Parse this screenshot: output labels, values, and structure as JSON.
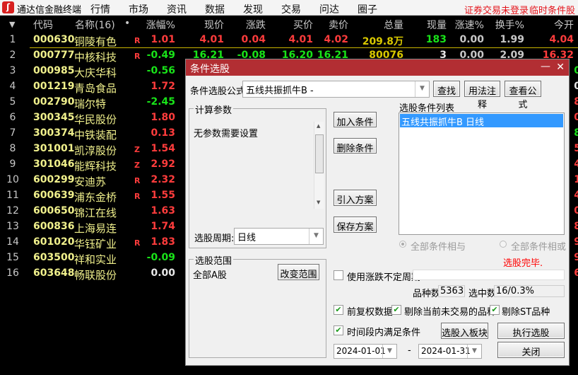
{
  "app": {
    "title": "通达信金融终端",
    "menu": [
      "行情",
      "市场",
      "资讯",
      "数据",
      "发现",
      "交易",
      "问达",
      "圈子"
    ],
    "login_status": "证券交易未登录",
    "temp_label": "临时条件股"
  },
  "table": {
    "headers": {
      "sort": "▼",
      "code": "代码",
      "name": "名称(16)",
      "dot": "•",
      "pct": "涨幅%",
      "price": "现价",
      "chg": "涨跌",
      "bid": "买价",
      "ask": "卖价",
      "vol": "总量",
      "cur": "现量",
      "speed": "涨速%",
      "turn": "换手%",
      "open": "今开"
    },
    "rows": [
      {
        "idx": "1",
        "code": "000630",
        "name": "铜陵有色",
        "mark": "R",
        "pct": "1.01",
        "price": "4.01",
        "chg": "0.04",
        "bid": "4.01",
        "ask": "4.02",
        "vol": "209.8万",
        "cur": "183",
        "speed": "0.00",
        "turn": "1.99",
        "open": "4.04",
        "color": "red"
      },
      {
        "idx": "2",
        "code": "000777",
        "name": "中核科技",
        "mark": "R",
        "pct": "-0.49",
        "price": "16.21",
        "chg": "-0.08",
        "bid": "16.20",
        "ask": "16.21",
        "vol": "80076",
        "cur": "3",
        "speed": "0.00",
        "turn": "2.09",
        "open": "16.32",
        "color": "grn"
      },
      {
        "idx": "3",
        "code": "000985",
        "name": "大庆华科",
        "mark": "",
        "pct": "-0.56",
        "open": "0",
        "color": "grn",
        "ocolor": "grn"
      },
      {
        "idx": "4",
        "code": "001219",
        "name": "青岛食品",
        "mark": "",
        "pct": "1.72",
        "open": "0",
        "color": "red",
        "ocolor": "wht"
      },
      {
        "idx": "5",
        "code": "002790",
        "name": "瑞尔特",
        "mark": "",
        "pct": "-2.45",
        "open": "8",
        "color": "grn",
        "ocolor": "red"
      },
      {
        "idx": "6",
        "code": "300345",
        "name": "华民股份",
        "mark": "",
        "pct": "1.80",
        "open": "0",
        "color": "red",
        "ocolor": "red"
      },
      {
        "idx": "7",
        "code": "300374",
        "name": "中铁装配",
        "mark": "",
        "pct": "0.13",
        "open": "8",
        "color": "red",
        "ocolor": "grn"
      },
      {
        "idx": "8",
        "code": "301001",
        "name": "凯淳股份",
        "mark": "Z",
        "pct": "1.54",
        "open": "5",
        "color": "red",
        "ocolor": "red"
      },
      {
        "idx": "9",
        "code": "301046",
        "name": "能辉科技",
        "mark": "Z",
        "pct": "2.92",
        "open": "4",
        "color": "red",
        "ocolor": "red"
      },
      {
        "idx": "10",
        "code": "600299",
        "name": "安迪苏",
        "mark": "R",
        "pct": "2.32",
        "open": "1",
        "color": "red",
        "ocolor": "red"
      },
      {
        "idx": "11",
        "code": "600639",
        "name": "浦东金桥",
        "mark": "R",
        "pct": "1.55",
        "open": "4",
        "color": "red",
        "ocolor": "red"
      },
      {
        "idx": "12",
        "code": "600650",
        "name": "锦江在线",
        "mark": "",
        "pct": "1.63",
        "open": "0",
        "color": "red",
        "ocolor": "red"
      },
      {
        "idx": "13",
        "code": "600836",
        "name": "上海易连",
        "mark": "",
        "pct": "1.74",
        "open": "8",
        "color": "red",
        "ocolor": "red"
      },
      {
        "idx": "14",
        "code": "601020",
        "name": "华钰矿业",
        "mark": "R",
        "pct": "1.83",
        "open": "9",
        "color": "red",
        "ocolor": "red"
      },
      {
        "idx": "15",
        "code": "603500",
        "name": "祥和实业",
        "mark": "",
        "pct": "-0.09",
        "open": "9",
        "color": "grn",
        "ocolor": "red"
      },
      {
        "idx": "16",
        "code": "603648",
        "name": "畅联股份",
        "mark": "",
        "pct": "0.00",
        "open": "6",
        "color": "wht",
        "ocolor": "red"
      }
    ]
  },
  "dialog": {
    "title": "条件选股",
    "minimize": "—",
    "close": "✕",
    "formula_label": "条件选股公式",
    "formula_value": "五线共振抓牛B -",
    "find": "查找",
    "usage": "用法注释",
    "view_formula": "查看公式",
    "params_group": "计算参数",
    "params_text": "无参数需要设置",
    "period_label": "选股周期:",
    "period_value": "日线",
    "add": "加入条件",
    "delete": "删除条件",
    "import": "引入方案",
    "save": "保存方案",
    "list_label": "选股条件列表",
    "list_items": [
      "五线共振抓牛B  日线"
    ],
    "radio_and": "全部条件相与",
    "radio_or": "全部条件相或",
    "range_group": "选股范围",
    "range_value": "全部A股",
    "change_range": "改变范围",
    "status": "选股完毕.",
    "use_period": "使用涨跌不定周期",
    "use_period_value": "",
    "count_label": "品种数",
    "count_value": "5363",
    "selected_label": "选中数",
    "selected_value": "16/0.3%",
    "fq": "前复权数据",
    "exclude_untraded": "剔除当前未交易的品种",
    "exclude_st": "剔除ST品种",
    "time_range": "时间段内满足条件",
    "to_block": "选股入板块",
    "execute": "执行选股",
    "date_from": "2024-01-01",
    "date_sep": "-",
    "date_to": "2024-01-31",
    "close_btn": "关闭",
    "check": "✔"
  }
}
